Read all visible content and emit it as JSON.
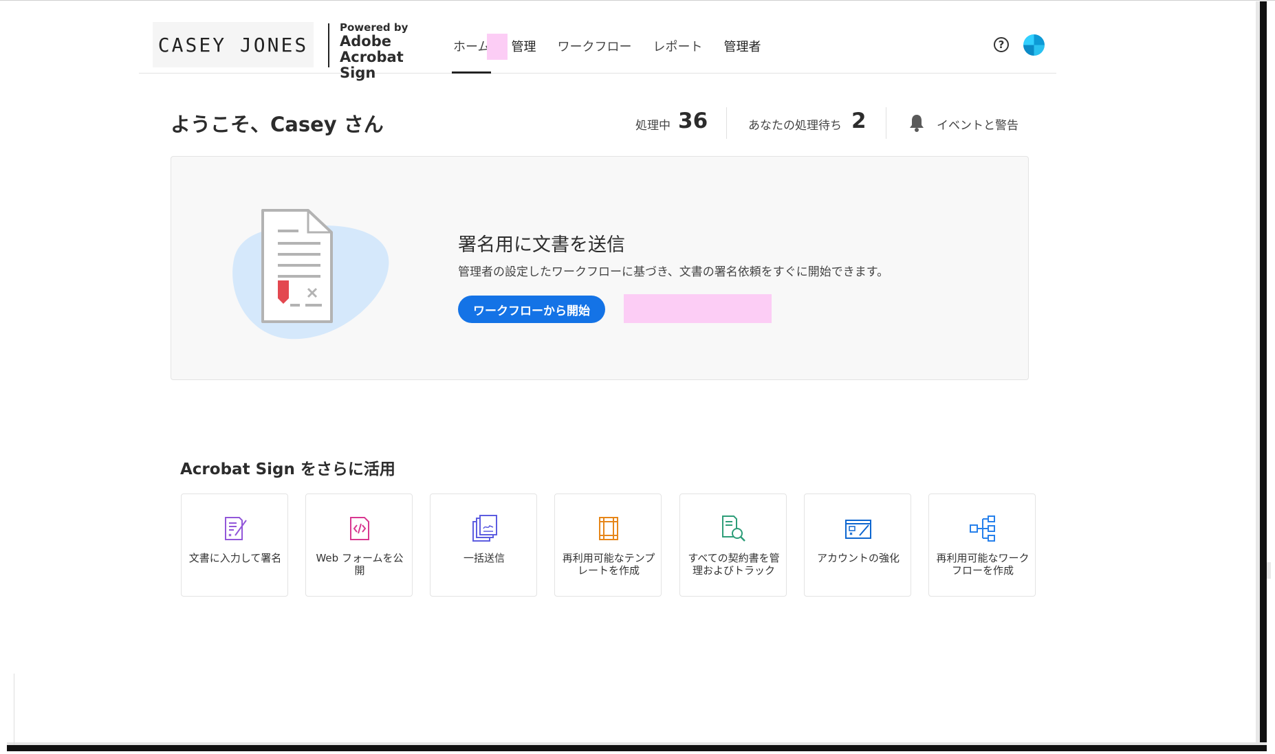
{
  "header": {
    "logo_text": "CASEY JONES",
    "powered_by": "Powered by",
    "adobe": "Adobe",
    "product": "Acrobat Sign",
    "nav": [
      {
        "label": "ホーム"
      },
      {
        "label": "管理"
      },
      {
        "label": "ワークフロー"
      },
      {
        "label": "レポート"
      },
      {
        "label": "管理者"
      }
    ],
    "help_glyph": "?"
  },
  "welcome": {
    "greeting": "ようこそ、Casey さん",
    "in_progress_label": "処理中",
    "in_progress_count": "36",
    "waiting_label": "あなたの処理待ち",
    "waiting_count": "2",
    "events_label": "イベントと警告"
  },
  "hero": {
    "title": "署名用に文書を送信",
    "description": "管理者の設定したワークフローに基づき、文書の署名依頼をすぐに開始できます。",
    "button_label": "ワークフローから開始"
  },
  "more": {
    "title": "Acrobat Sign をさらに活用",
    "tiles": [
      {
        "label": "文書に入力して署名",
        "icon": "fill-sign-icon",
        "color": "#9256d9"
      },
      {
        "label": "Web フォームを公開",
        "icon": "web-form-icon",
        "color": "#d83790"
      },
      {
        "label": "一括送信",
        "icon": "bulk-send-icon",
        "color": "#5c5ce0"
      },
      {
        "label": "再利用可能なテンプレートを作成",
        "icon": "template-icon",
        "color": "#e68619"
      },
      {
        "label": "すべての契約書を管理およびトラック",
        "icon": "manage-track-icon",
        "color": "#2d9d78"
      },
      {
        "label": "アカウントの強化",
        "icon": "account-enhance-icon",
        "color": "#0d66d0"
      },
      {
        "label": "再利用可能なワークフローを作成",
        "icon": "workflow-icon",
        "color": "#2680eb"
      }
    ]
  },
  "colors": {
    "primary_button": "#1473e6",
    "redaction": "#fccdf5",
    "illustration_blob": "#d5e8fb",
    "signature_flag": "#e34850"
  }
}
